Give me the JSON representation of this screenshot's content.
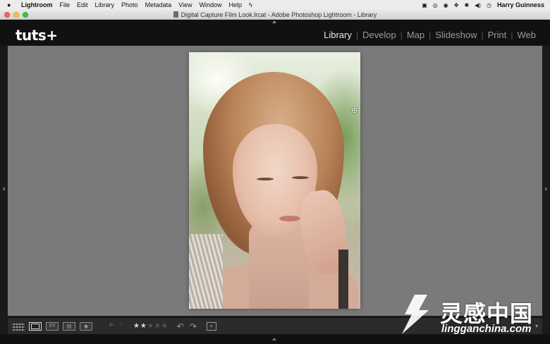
{
  "menubar": {
    "app": "Lightroom",
    "items": [
      "File",
      "Edit",
      "Library",
      "Photo",
      "Metadata",
      "View",
      "Window",
      "Help"
    ],
    "user": "Harry Guinness"
  },
  "window": {
    "title": "Digital Capture Film Look.lrcat - Adobe Photoshop Lightroom - Library"
  },
  "identity_plate": "tuts+",
  "modules": [
    {
      "label": "Library",
      "active": true
    },
    {
      "label": "Develop",
      "active": false
    },
    {
      "label": "Map",
      "active": false
    },
    {
      "label": "Slideshow",
      "active": false
    },
    {
      "label": "Print",
      "active": false
    },
    {
      "label": "Web",
      "active": false
    }
  ],
  "toolbar": {
    "rating": 2,
    "rating_max": 5,
    "flag_pick": "⚑",
    "flag_reject": "⚐",
    "rotate_left": "↶",
    "rotate_right": "↷"
  },
  "watermark": {
    "text": "灵感中国",
    "url": "lingganchina.com"
  },
  "colors": {
    "loupe_bg": "#7a7a7a",
    "active_module": "#e8e8e8",
    "inactive_module": "#9a9a9a"
  }
}
